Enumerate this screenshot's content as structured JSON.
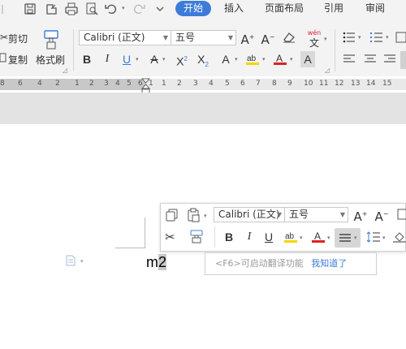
{
  "menu": {
    "start": "开始",
    "insert": "插入",
    "page_layout": "页面布局",
    "references": "引用",
    "review": "审阅"
  },
  "ribbon": {
    "cut": "剪切",
    "copy": "复制",
    "format_painter": "格式刷",
    "font_name": "Calibri (正文)",
    "font_size": "五号",
    "bold": "B",
    "italic": "I",
    "underline": "U",
    "translate_top": "wén",
    "translate_bottom": "文"
  },
  "ruler": {
    "left_numbers": [
      "8",
      "6",
      "4",
      "2",
      "1",
      "2",
      "3",
      "4",
      "5",
      "6",
      "1"
    ],
    "right_numbers": [
      "1",
      "2",
      "3",
      "4",
      "5",
      "6",
      "7",
      "8",
      "9",
      "10",
      "11",
      "12",
      "13",
      "14",
      "15"
    ]
  },
  "mini_toolbar": {
    "font_name": "Calibri (正文)",
    "font_size": "五号",
    "bold": "B",
    "italic": "I",
    "underline": "U"
  },
  "document": {
    "text_plain": "m",
    "text_selected": "2"
  },
  "hint": {
    "text": "<F6>可启动翻译功能",
    "link": "我知道了"
  },
  "colors": {
    "accent": "#3d7bd8",
    "ruler_gray": "#c8c8c8"
  }
}
